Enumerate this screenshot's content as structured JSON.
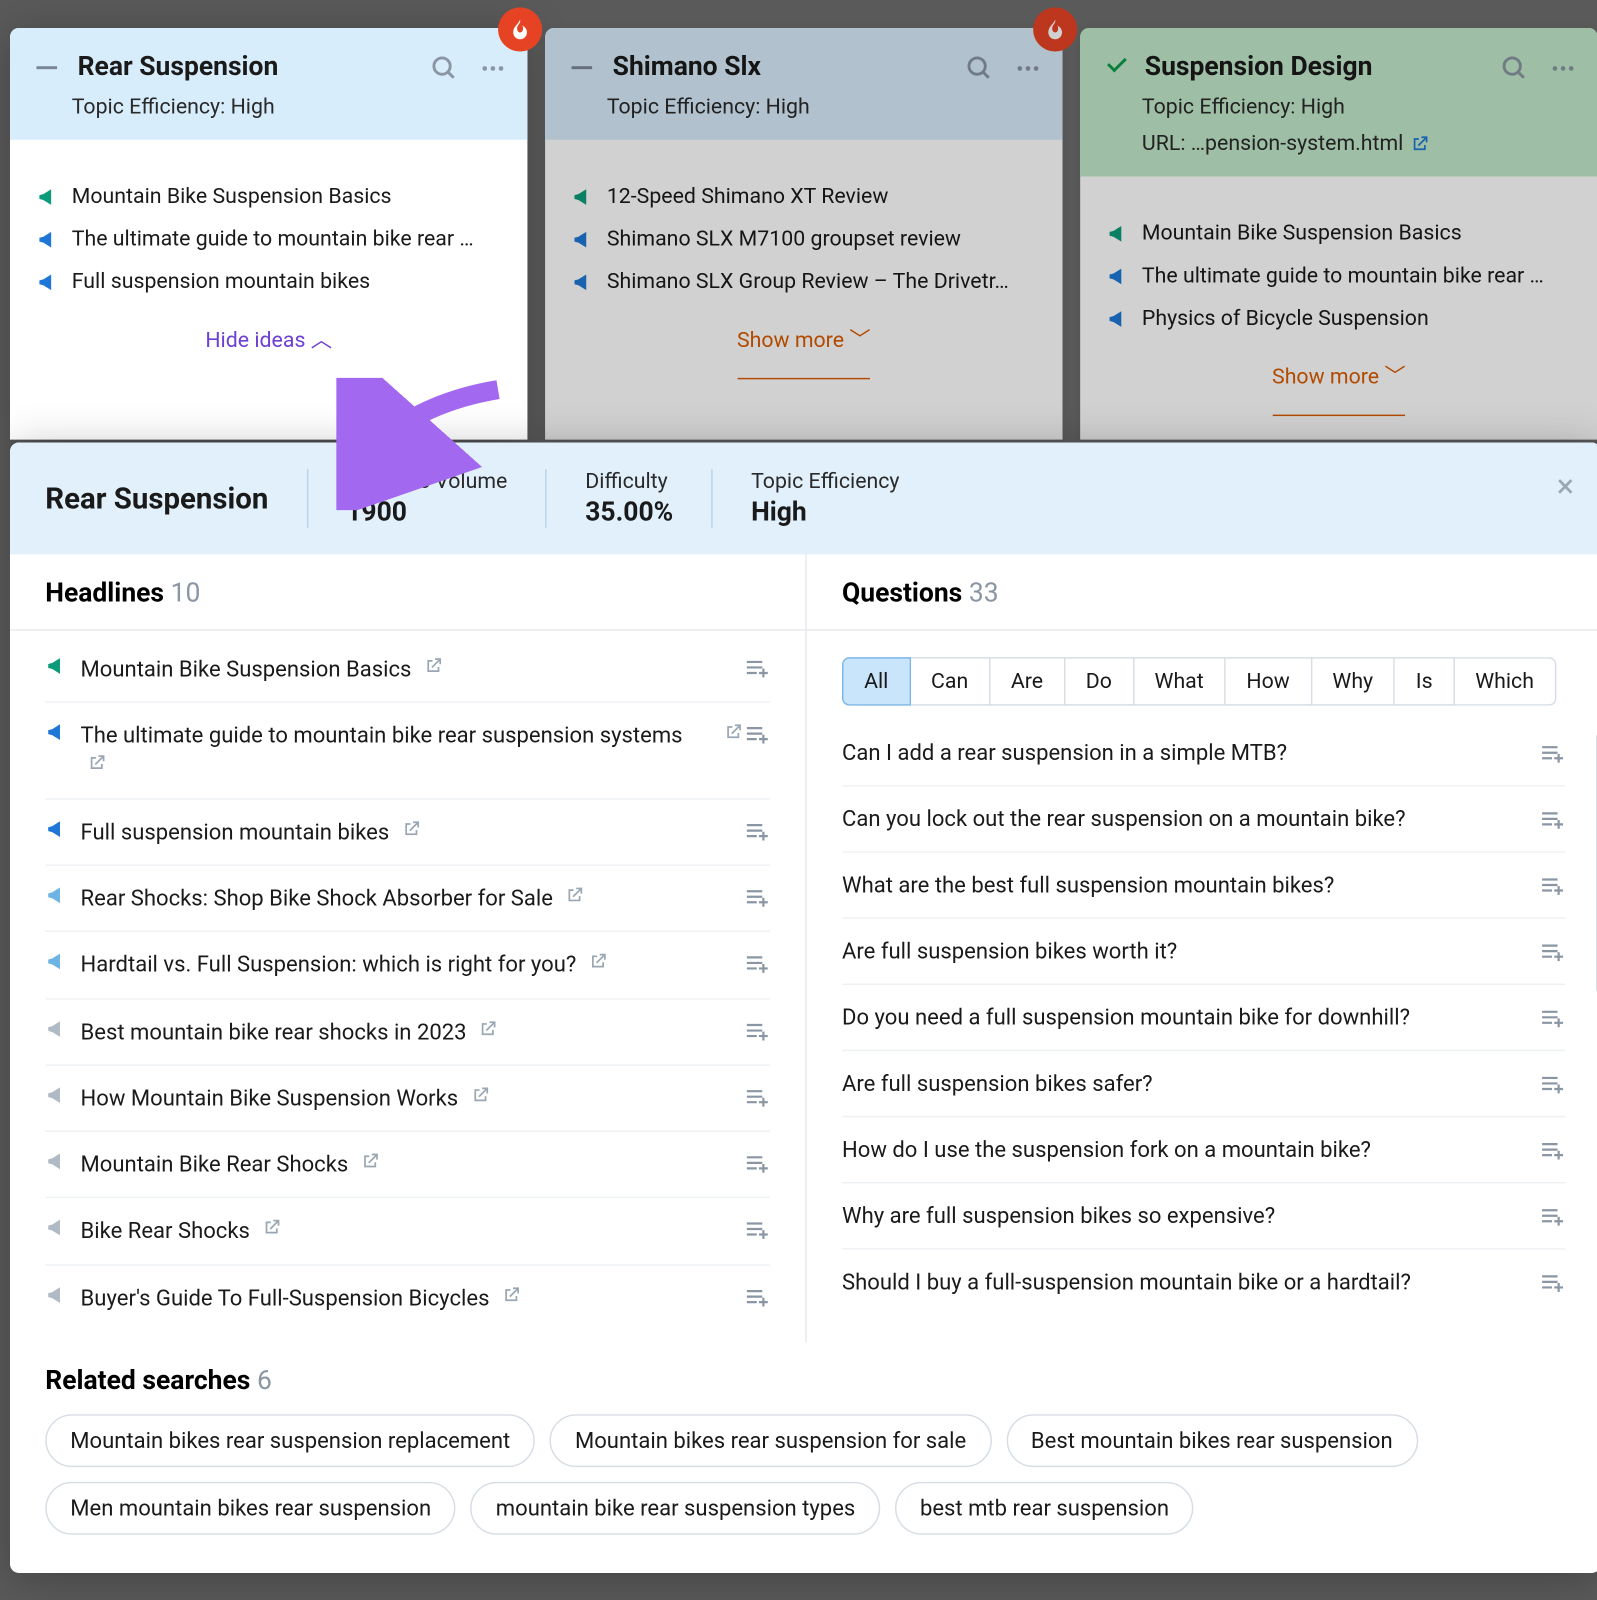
{
  "cards": [
    {
      "title": "Rear Suspension",
      "efficiency": "Topic Efficiency:  High",
      "ideas": [
        "Mountain Bike Suspension Basics",
        "The ultimate guide to mountain bike rear …",
        "Full suspension mountain bikes"
      ],
      "toggle": "Hide ideas"
    },
    {
      "title": "Shimano Slx",
      "efficiency": "Topic Efficiency:  High",
      "ideas": [
        "12-Speed Shimano XT Review",
        "Shimano SLX M7100 groupset review",
        "Shimano SLX Group Review – The Drivetr…"
      ],
      "toggle": "Show more"
    },
    {
      "title": "Suspension Design",
      "efficiency": "Topic Efficiency:  High",
      "url": "URL:  …pension-system.html",
      "ideas": [
        "Mountain Bike Suspension Basics",
        "The ultimate guide to mountain bike rear …",
        "Physics of Bicycle Suspension"
      ],
      "toggle": "Show more"
    }
  ],
  "panel": {
    "title": "Rear Suspension",
    "stats": {
      "vol_label": "Subtopic Volume",
      "vol": "1900",
      "diff_label": "Difficulty",
      "diff": "35.00%",
      "eff_label": "Topic Efficiency",
      "eff": "High"
    },
    "headlines_label": "Headlines",
    "headlines_count": "10",
    "headlines": [
      {
        "t": "Mountain Bike Suspension Basics",
        "c": "green"
      },
      {
        "t": "The ultimate guide to mountain bike rear suspension systems",
        "c": "blue"
      },
      {
        "t": "Full suspension mountain bikes",
        "c": "blue"
      },
      {
        "t": "Rear Shocks: Shop Bike Shock Absorber for Sale",
        "c": "lblue"
      },
      {
        "t": "Hardtail vs. Full Suspension: which is right for you?",
        "c": "lblue"
      },
      {
        "t": "Best mountain bike rear shocks in 2023",
        "c": "grey"
      },
      {
        "t": "How Mountain Bike Suspension Works",
        "c": "grey"
      },
      {
        "t": "Mountain Bike Rear Shocks",
        "c": "grey"
      },
      {
        "t": "Bike Rear Shocks",
        "c": "grey"
      },
      {
        "t": "Buyer's Guide To Full-Suspension Bicycles",
        "c": "grey"
      }
    ],
    "questions_label": "Questions",
    "questions_count": "33",
    "filters": [
      "All",
      "Can",
      "Are",
      "Do",
      "What",
      "How",
      "Why",
      "Is",
      "Which"
    ],
    "questions": [
      "Can I add a rear suspension in a simple MTB?",
      "Can you lock out the rear suspension on a mountain bike?",
      "What are the best full suspension mountain bikes?",
      "Are full suspension bikes worth it?",
      "Do you need a full suspension mountain bike for downhill?",
      "Are full suspension bikes safer?",
      "How do I use the suspension fork on a mountain bike?",
      "Why are full suspension bikes so expensive?",
      "Should I buy a full-suspension mountain bike or a hardtail?"
    ],
    "rel_label": "Related searches",
    "rel_count": "6",
    "related": [
      "Mountain bikes rear suspension replacement",
      "Mountain bikes rear suspension for sale",
      "Best mountain bikes rear suspension",
      "Men mountain bikes rear suspension",
      "mountain bike rear suspension types",
      "best mtb rear suspension"
    ]
  }
}
